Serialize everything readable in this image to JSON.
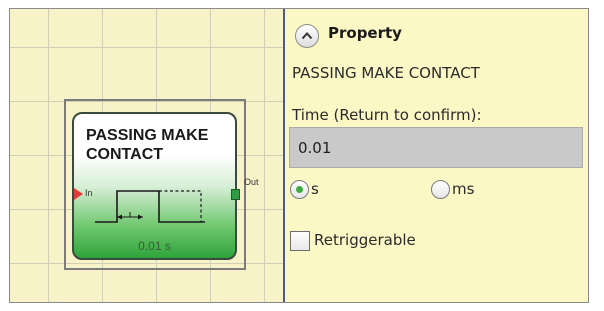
{
  "block": {
    "title_line1": "PASSING MAKE",
    "title_line2": "CONTACT",
    "input_label": "In",
    "output_label": "Out",
    "value_label": "0.01 s"
  },
  "property_panel": {
    "title": "Property",
    "subtitle": "PASSING MAKE CONTACT",
    "time_label": "Time (Return to confirm):",
    "time_value": "0.01",
    "unit_options": [
      {
        "label": "s",
        "selected": true
      },
      {
        "label": "ms",
        "selected": false
      }
    ],
    "retriggerable_label": "Retriggerable",
    "retriggerable_checked": false
  },
  "icons": {
    "collapse": "chevron-up-icon",
    "input_pin": "triangle-right-icon",
    "output_pin": "square-pin-icon"
  },
  "colors": {
    "canvas_bg": "#f7f2c8",
    "panel_bg": "#fbf8c6",
    "block_green": "#2ea43a",
    "input_pin": "#e23b3b",
    "radio_selected": "#3faa3f"
  }
}
